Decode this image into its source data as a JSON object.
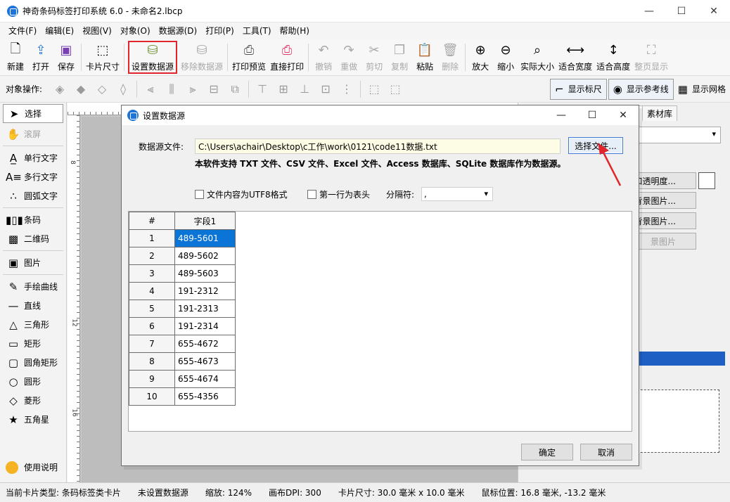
{
  "window": {
    "title": "神奇条码标签打印系统 6.0 - 未命名2.lbcp",
    "minimize": "—",
    "maximize": "☐",
    "close": "✕"
  },
  "menu": [
    "文件(F)",
    "编辑(E)",
    "视图(V)",
    "对象(O)",
    "数据源(D)",
    "打印(P)",
    "工具(T)",
    "帮助(H)"
  ],
  "toolbar": {
    "new": "新建",
    "open": "打开",
    "save": "保存",
    "card_size": "卡片尺寸",
    "set_datasource": "设置数据源",
    "remove_datasource": "移除数据源",
    "print_preview": "打印预览",
    "direct_print": "直接打印",
    "undo": "撤销",
    "redo": "重做",
    "cut": "剪切",
    "copy": "复制",
    "paste": "粘贴",
    "delete": "删除",
    "zoom_in": "放大",
    "zoom_out": "缩小",
    "actual_size": "实际大小",
    "fit_width": "适合宽度",
    "fit_height": "适合高度",
    "full_page": "整页显示"
  },
  "objbar": {
    "label": "对象操作:",
    "show_ruler": "显示标尺",
    "show_guides": "显示参考线",
    "show_grid": "显示网格"
  },
  "tools": {
    "select": "选择",
    "scroll": "滚屏",
    "single_text": "单行文字",
    "multi_text": "多行文字",
    "arc_text": "圆弧文字",
    "barcode": "条码",
    "qrcode": "二维码",
    "image": "图片",
    "freehand": "手绘曲线",
    "line": "直线",
    "triangle": "三角形",
    "rect": "矩形",
    "round_rect": "圆角矩形",
    "circle": "圆形",
    "diamond": "菱形",
    "star": "五角星",
    "help": "使用说明"
  },
  "ruler": {
    "n1": "8",
    "n2": "12",
    "n3": "16"
  },
  "right_panel": {
    "tab_library": "素材库",
    "btn_transparency": "和透明度...",
    "btn_bg_image1": "背景图片...",
    "btn_bg_image2": "背景图片...",
    "btn_bg_image3": "景图片"
  },
  "dialog": {
    "title": "设置数据源",
    "file_label": "数据源文件:",
    "file_path": "C:\\Users\\achair\\Desktop\\c工作\\work\\0121\\code11数据.txt",
    "choose_file": "选择文件...",
    "support_note": "本软件支持 TXT 文件、CSV 文件、Excel 文件、Access 数据库、SQLite 数据库作为数据源。",
    "utf8_label": "文件内容为UTF8格式",
    "header_label": "第一行为表头",
    "separator_label": "分隔符:",
    "separator_value": ",",
    "grid": {
      "headers": [
        "#",
        "字段1"
      ],
      "rows": [
        [
          "1",
          "489-5601"
        ],
        [
          "2",
          "489-5602"
        ],
        [
          "3",
          "489-5603"
        ],
        [
          "4",
          "191-2312"
        ],
        [
          "5",
          "191-2313"
        ],
        [
          "6",
          "191-2314"
        ],
        [
          "7",
          "655-4672"
        ],
        [
          "8",
          "655-4673"
        ],
        [
          "9",
          "655-4674"
        ],
        [
          "10",
          "655-4356"
        ]
      ]
    },
    "ok": "确定",
    "cancel": "取消"
  },
  "status": {
    "card_type": "当前卡片类型:  条码标签类卡片",
    "datasource": "未设置数据源",
    "zoom": "缩放:  124%",
    "dpi": "画布DPI:  300",
    "card_size": "卡片尺寸:  30.0 毫米 x 10.0 毫米",
    "mouse_pos": "鼠标位置:  16.8 毫米, -13.2 毫米"
  },
  "colors": {
    "accent": "#1e73d8",
    "highlight_border": "#e0262c",
    "selected_cell": "#0a74d7"
  }
}
